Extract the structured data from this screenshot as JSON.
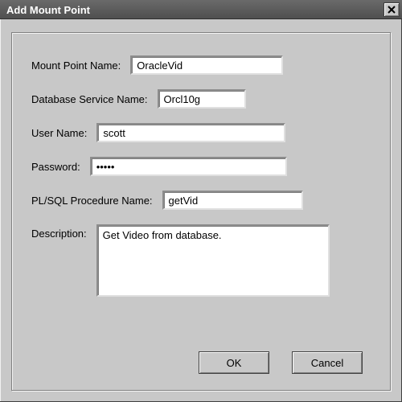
{
  "window": {
    "title": "Add Mount Point"
  },
  "labels": {
    "mount_point": "Mount Point Name:",
    "db_service": "Database Service Name:",
    "user_name": "User Name:",
    "password": "Password:",
    "proc_name": "PL/SQL Procedure Name:",
    "description": "Description:"
  },
  "values": {
    "mount_point": "OracleVid",
    "db_service": "Orcl10g",
    "user_name": "scott",
    "password": "•••••",
    "proc_name": "getVid",
    "description": "Get Video from database."
  },
  "buttons": {
    "ok": "OK",
    "cancel": "Cancel"
  }
}
